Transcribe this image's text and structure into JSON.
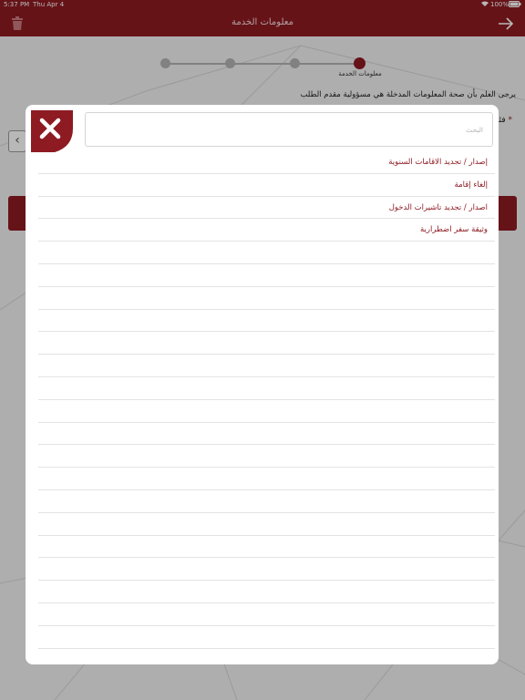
{
  "status_bar": {
    "time": "5:37 PM",
    "date": "Thu Apr 4",
    "battery": "100%"
  },
  "nav": {
    "title": "معلومات الخدمة",
    "delete_icon": "trash-icon",
    "forward_icon": "arrow-right-icon"
  },
  "stepper": {
    "steps_count": 4,
    "active_step": 4,
    "active_label": "معلومات الخدمة"
  },
  "form": {
    "notice": "يرجى العلم بأن صحة المعلومات المدخلة هي مسؤولية مقدم الطلب",
    "field_label_partial": "فئة",
    "field_required_mark": "*"
  },
  "modal": {
    "close_icon": "close-icon",
    "search": {
      "placeholder": "البحث",
      "value": ""
    },
    "items": [
      "إصدار / تجديد الاقامات السنوية",
      "إلغاء إقامة",
      "اصدار / تجديد تاشيرات الدخول",
      "وثيقة سفر اضطرارية",
      "",
      "",
      "",
      "",
      "",
      "",
      "",
      "",
      "",
      "",
      "",
      "",
      "",
      "",
      "",
      "",
      "",
      "",
      ""
    ]
  },
  "colors": {
    "brand": "#8e1b22",
    "item_text": "#8e1b22",
    "divider": "#e3e3e3"
  }
}
